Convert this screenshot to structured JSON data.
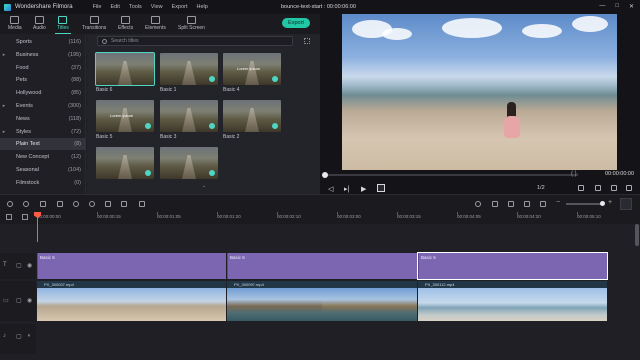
{
  "titlebar": {
    "app_name": "Wondershare Filmora",
    "menu": [
      "File",
      "Edit",
      "Tools",
      "View",
      "Export",
      "Help"
    ],
    "project_name": "bounce-text-start",
    "timecode": "00:00:06:00"
  },
  "toolbar": {
    "tabs": [
      "Media",
      "Audio",
      "Titles",
      "Transitions",
      "Effects",
      "Elements",
      "Split Screen"
    ],
    "active_tab": "Titles",
    "export_label": "Export"
  },
  "categories": [
    {
      "label": "Sports",
      "count": "(116)",
      "arrow": ""
    },
    {
      "label": "Business",
      "count": "(195)",
      "arrow": "▸"
    },
    {
      "label": "Food",
      "count": "(37)",
      "arrow": ""
    },
    {
      "label": "Pets",
      "count": "(88)",
      "arrow": ""
    },
    {
      "label": "Hollywood",
      "count": "(85)",
      "arrow": ""
    },
    {
      "label": "Events",
      "count": "(300)",
      "arrow": "▸"
    },
    {
      "label": "News",
      "count": "(118)",
      "arrow": ""
    },
    {
      "label": "Styles",
      "count": "(72)",
      "arrow": "▸"
    },
    {
      "label": "Plain Text",
      "count": "(8)",
      "arrow": ""
    },
    {
      "label": "New Concept",
      "count": "(12)",
      "arrow": ""
    },
    {
      "label": "Seasonal",
      "count": "(104)",
      "arrow": ""
    },
    {
      "label": "Filmstock",
      "count": "(0)",
      "arrow": ""
    }
  ],
  "active_category": "Plain Text",
  "search": {
    "placeholder": "Search titles"
  },
  "titles": [
    {
      "label": "Basic 6",
      "overlay": ""
    },
    {
      "label": "Basic 1",
      "overlay": ""
    },
    {
      "label": "Basic 4",
      "overlay": "Lorem ipsum"
    },
    {
      "label": "Basic 5",
      "overlay": "Lorem ipsum"
    },
    {
      "label": "Basic 3",
      "overlay": ""
    },
    {
      "label": "Basic 2",
      "overlay": ""
    },
    {
      "label": "",
      "overlay": ""
    },
    {
      "label": "",
      "overlay": ""
    }
  ],
  "preview": {
    "timecode": "00:00:00:00",
    "ratio": "1/2",
    "brackets": "{  }"
  },
  "ruler_ticks": [
    "00:00:00:00",
    "00:00:00:15",
    "00:00:01:05",
    "00:00:01:20",
    "00:00:02:10",
    "00:00:03:00",
    "00:00:03:15",
    "00:00:04:05",
    "00:00:04:20",
    "00:00:05:10"
  ],
  "timeline": {
    "title_clips": [
      "Basic 6",
      "Basic 6",
      "Basic 6"
    ],
    "video_clips": [
      "PX_300007.mp4",
      "PX_300097.mp4",
      "PX_300112.mp4"
    ]
  },
  "colors": {
    "accent": "#4fd6c3",
    "export": "#22c7a6",
    "title_clip": "#7c66b2",
    "playhead": "#ff5a48"
  }
}
